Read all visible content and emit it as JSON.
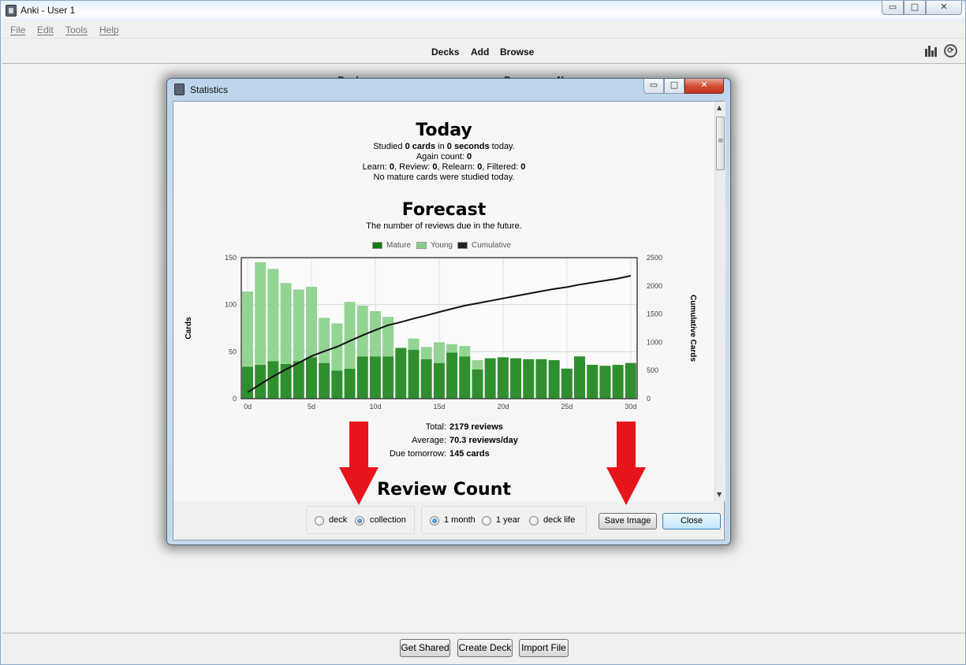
{
  "window": {
    "title": "Anki - User 1"
  },
  "menu": [
    "File",
    "Edit",
    "Tools",
    "Help"
  ],
  "toolbar": {
    "decks": "Decks",
    "add": "Add",
    "browse": "Browse",
    "stats_icon": "bar-chart-icon",
    "sync_icon": "sync-icon",
    "sync_glyph": "⟳"
  },
  "caption": {
    "minimize": "▭",
    "maximize": "□",
    "close": "✕"
  },
  "behind_headers": {
    "deck": "Deck",
    "due": "Due",
    "new": "New"
  },
  "bottom_buttons": {
    "get_shared": "Get Shared",
    "create_deck": "Create Deck",
    "import_file": "Import File"
  },
  "stats_dialog": {
    "title": "Statistics",
    "today": {
      "heading": "Today",
      "studied_prefix": "Studied ",
      "studied_cards": "0 cards",
      "studied_mid": " in ",
      "studied_time": "0 seconds",
      "studied_suffix": " today.",
      "again_label": "Again count: ",
      "again_value": "0",
      "learn_label": "Learn: ",
      "learn_value": "0",
      "review_label": ", Review: ",
      "review_value": "0",
      "relearn_label": ", Relearn: ",
      "relearn_value": "0",
      "filtered_label": ", Filtered: ",
      "filtered_value": "0",
      "mature_note": "No mature cards were studied today."
    },
    "forecast": {
      "heading": "Forecast",
      "subtitle": "The number of reviews due in the future.",
      "legend": [
        "Mature",
        "Young",
        "Cumulative"
      ],
      "total_label": "Total:",
      "total_value": "2179 reviews",
      "average_label": "Average:",
      "average_value": "70.3 reviews/day",
      "due_label": "Due tomorrow:",
      "due_value": "145 cards"
    },
    "review_count_heading": "Review Count",
    "options": {
      "deck": "deck",
      "collection": "collection",
      "one_month": "1 month",
      "one_year": "1 year",
      "deck_life": "deck life",
      "selected_scope": "collection",
      "selected_period": "1 month"
    },
    "buttons": {
      "save_image": "Save Image",
      "close": "Close"
    }
  },
  "colors": {
    "mature": "#2f8f2f",
    "young": "#93d493",
    "cumulative": "#111111",
    "annotation_arrow": "#e8141c"
  },
  "chart_data": {
    "type": "bar",
    "stacked": true,
    "x": [
      0,
      1,
      2,
      3,
      4,
      5,
      6,
      7,
      8,
      9,
      10,
      11,
      12,
      13,
      14,
      15,
      16,
      17,
      18,
      19,
      20,
      21,
      22,
      23,
      24,
      25,
      26,
      27,
      28,
      29,
      30
    ],
    "series": [
      {
        "name": "Mature",
        "axis": "left",
        "values": [
          34,
          36,
          40,
          37,
          40,
          44,
          38,
          30,
          32,
          45,
          45,
          45,
          54,
          52,
          42,
          38,
          49,
          45,
          31,
          43,
          44,
          43,
          42,
          42,
          41,
          32,
          45,
          36,
          35,
          36,
          38
        ]
      },
      {
        "name": "Young",
        "axis": "left",
        "values": [
          80,
          109,
          98,
          86,
          76,
          75,
          48,
          50,
          71,
          54,
          48,
          42,
          0,
          12,
          13,
          22,
          9,
          11,
          10,
          0,
          0,
          0,
          0,
          0,
          0,
          0,
          0,
          0,
          0,
          0,
          0
        ]
      },
      {
        "name": "Cumulative",
        "type": "line",
        "axis": "right",
        "values": [
          114,
          259,
          397,
          520,
          636,
          755,
          841,
          921,
          1024,
          1123,
          1216,
          1303,
          1357,
          1421,
          1476,
          1536,
          1594,
          1650,
          1691,
          1734,
          1778,
          1821,
          1863,
          1905,
          1946,
          1978,
          2023,
          2059,
          2094,
          2130,
          2179
        ]
      }
    ],
    "xticks": [
      "0d",
      "5d",
      "10d",
      "15d",
      "20d",
      "25d",
      "30d"
    ],
    "ylabel": "Cards",
    "y2label": "Cumulative Cards",
    "ylim": [
      0,
      150
    ],
    "y2lim": [
      0,
      2500
    ],
    "yticks": [
      0,
      50,
      100,
      150
    ],
    "y2ticks": [
      0,
      500,
      1000,
      1500,
      2000,
      2500
    ],
    "grid": true,
    "legend_position": "top"
  }
}
